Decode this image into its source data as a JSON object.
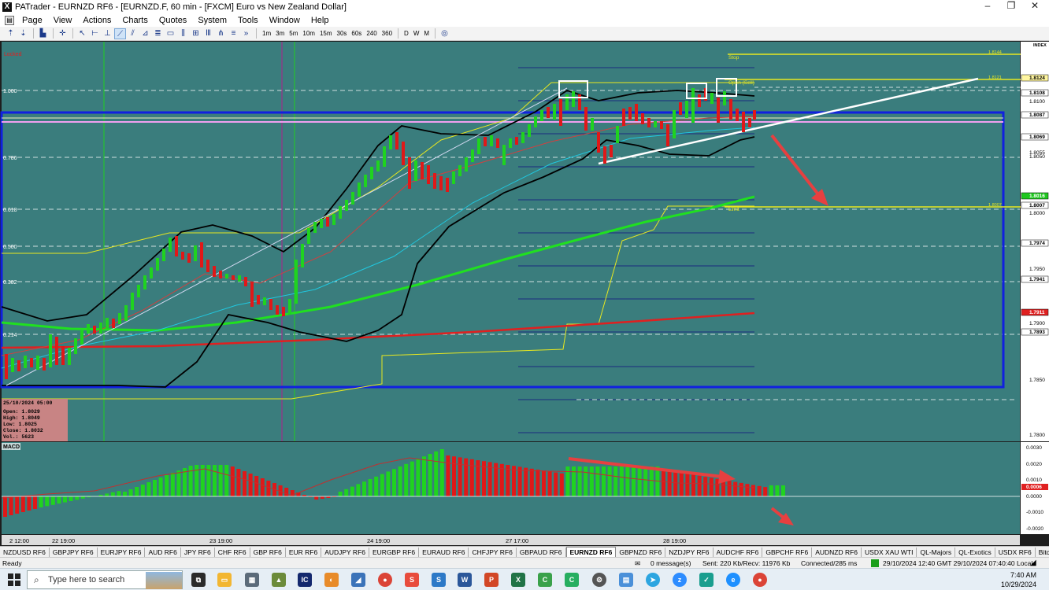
{
  "window": {
    "app_icon": "X",
    "title": "PATrader - EURNZD RF6 - [EURNZD.F, 60 min - [FXCM] Euro vs New Zealand Dollar]",
    "controls": [
      "–",
      "❐",
      "✕"
    ]
  },
  "menu": {
    "items": [
      "Page",
      "View",
      "Actions",
      "Charts",
      "Quotes",
      "System",
      "Tools",
      "Window",
      "Help"
    ],
    "mdi_controls": [
      "_",
      "▫",
      "✕"
    ]
  },
  "toolbar": {
    "timeframes": [
      "1m",
      "3m",
      "5m",
      "10m",
      "15m",
      "30s",
      "60s",
      "240",
      "360"
    ],
    "periods": [
      "D",
      "W",
      "M"
    ],
    "more": "»"
  },
  "chart": {
    "locked_label": "Locked",
    "index_label": "INDEX",
    "left_levels": [
      "1.000",
      "0.786",
      "0.618",
      "0.500",
      "0.382",
      "0.214"
    ],
    "annotations": {
      "stop": "Stop",
      "open_sell": "Open (Sell)",
      "limit": "Limit"
    },
    "line_values": {
      "stop": "1.8144",
      "open": "1.8121",
      "limit": "1.8007"
    },
    "price_axis": [
      "1.8124",
      "1.8108",
      "1.8100",
      "1.8087",
      "1.8069",
      "1.8055",
      "1.8050",
      "1.8016",
      "1.8007",
      "1.8000",
      "1.7974",
      "1.7950",
      "1.7941",
      "1.7911",
      "1.7900",
      "1.7893",
      "1.7850",
      "1.7800"
    ],
    "time_axis": [
      "2 12:00",
      "22 19:00",
      "23 19:00",
      "24 19:00",
      "27 17:00",
      "28 19:00"
    ],
    "ohlc_box": {
      "date": "25/10/2024 05:00",
      "open": "Open: 1.8029",
      "high": "High: 1.8049",
      "low": "Low: 1.8025",
      "close": "Close: 1.8032",
      "vol": "Vol.: 5623"
    },
    "macd_label": "MACD",
    "macd_axis": [
      "0.0030",
      "0.0020",
      "0.0010",
      "0.0000",
      "-0.0010",
      "-0.0020"
    ],
    "macd_current": "0.0006",
    "colors": {
      "background": "#3a7d7d",
      "bull": "#1fd31f",
      "bear": "#e01818",
      "blue_box": "#1020e0",
      "yellow": "#e8e820",
      "white": "#ffffff"
    }
  },
  "tabs": [
    "NZDUSD RF6",
    "GBPJPY RF6",
    "EURJPY RF6",
    "AUD RF6",
    "JPY RF6",
    "CHF RF6",
    "GBP RF6",
    "EUR RF6",
    "AUDJPY RF6",
    "EURGBP RF6",
    "EURAUD RF6",
    "CHFJPY RF6",
    "GBPAUD RF6",
    "EURNZD RF6",
    "GBPNZD RF6",
    "NZDJPY RF6",
    "AUDCHF RF6",
    "GBPCHF RF6",
    "AUDNZD RF6",
    "USDX XAU WTI",
    "QL-Majors",
    "QL-Exotics",
    "USDX RF6",
    "Bitcoin",
    "SP500 RF6",
    "DJIA"
  ],
  "active_tab": "EURNZD RF6",
  "status": {
    "ready": "Ready",
    "messages": "0 message(s)",
    "traffic": "Sent: 220 Kb/Recv: 11976 Kb",
    "connection": "Connected/285 ms",
    "datetime": "29/10/2024 12:40 GMT  29/10/2024 07:40:40 Local"
  },
  "taskbar": {
    "search_placeholder": "Type here to search",
    "time": "7:40 AM",
    "date": "10/29/2024"
  }
}
